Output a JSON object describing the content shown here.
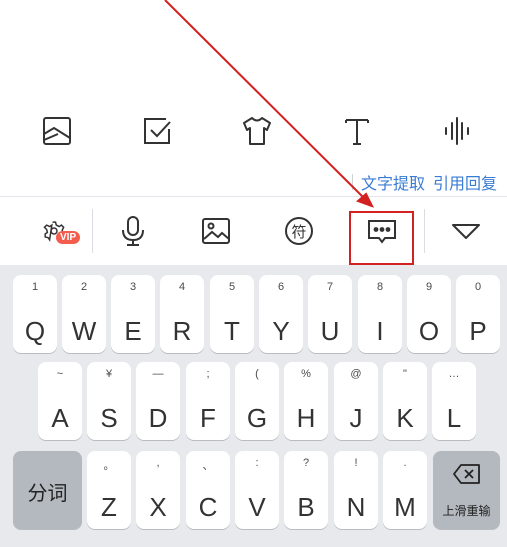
{
  "toolbar_top": {
    "icons": [
      "image-frame-icon",
      "checkbox-icon",
      "tshirt-icon",
      "text-icon",
      "voice-wave-icon"
    ]
  },
  "links": {
    "text_extract": "文字提取",
    "quote_reply": "引用回复"
  },
  "toolbar_keyboard": {
    "vip_badge": "VIP",
    "icons": [
      "settings-vip-icon",
      "microphone-icon",
      "picture-icon",
      "symbol-icon",
      "message-bubble-icon",
      "collapse-icon"
    ],
    "symbol_char": "符"
  },
  "keyboard": {
    "row1": [
      {
        "sub": "1",
        "main": "Q"
      },
      {
        "sub": "2",
        "main": "W"
      },
      {
        "sub": "3",
        "main": "E"
      },
      {
        "sub": "4",
        "main": "R"
      },
      {
        "sub": "5",
        "main": "T"
      },
      {
        "sub": "6",
        "main": "Y"
      },
      {
        "sub": "7",
        "main": "U"
      },
      {
        "sub": "8",
        "main": "I"
      },
      {
        "sub": "9",
        "main": "O"
      },
      {
        "sub": "0",
        "main": "P"
      }
    ],
    "row2": [
      {
        "sub": "~",
        "main": "A"
      },
      {
        "sub": "¥",
        "main": "S"
      },
      {
        "sub": "—",
        "main": "D"
      },
      {
        "sub": ";",
        "main": "F"
      },
      {
        "sub": "(",
        "main": "G"
      },
      {
        "sub": "%",
        "main": "H"
      },
      {
        "sub": "@",
        "main": "J"
      },
      {
        "sub": "\"",
        "main": "K"
      },
      {
        "sub": "…",
        "main": "L"
      }
    ],
    "row3": [
      {
        "sub": "。",
        "main": "Z"
      },
      {
        "sub": ",",
        "main": "X"
      },
      {
        "sub": "、",
        "main": "C"
      },
      {
        "sub": ":",
        "main": "V"
      },
      {
        "sub": "?",
        "main": "B"
      },
      {
        "sub": "!",
        "main": "N"
      },
      {
        "sub": ".",
        "main": "M"
      }
    ],
    "fenci": "分词",
    "delete_label": "上滑重输"
  }
}
